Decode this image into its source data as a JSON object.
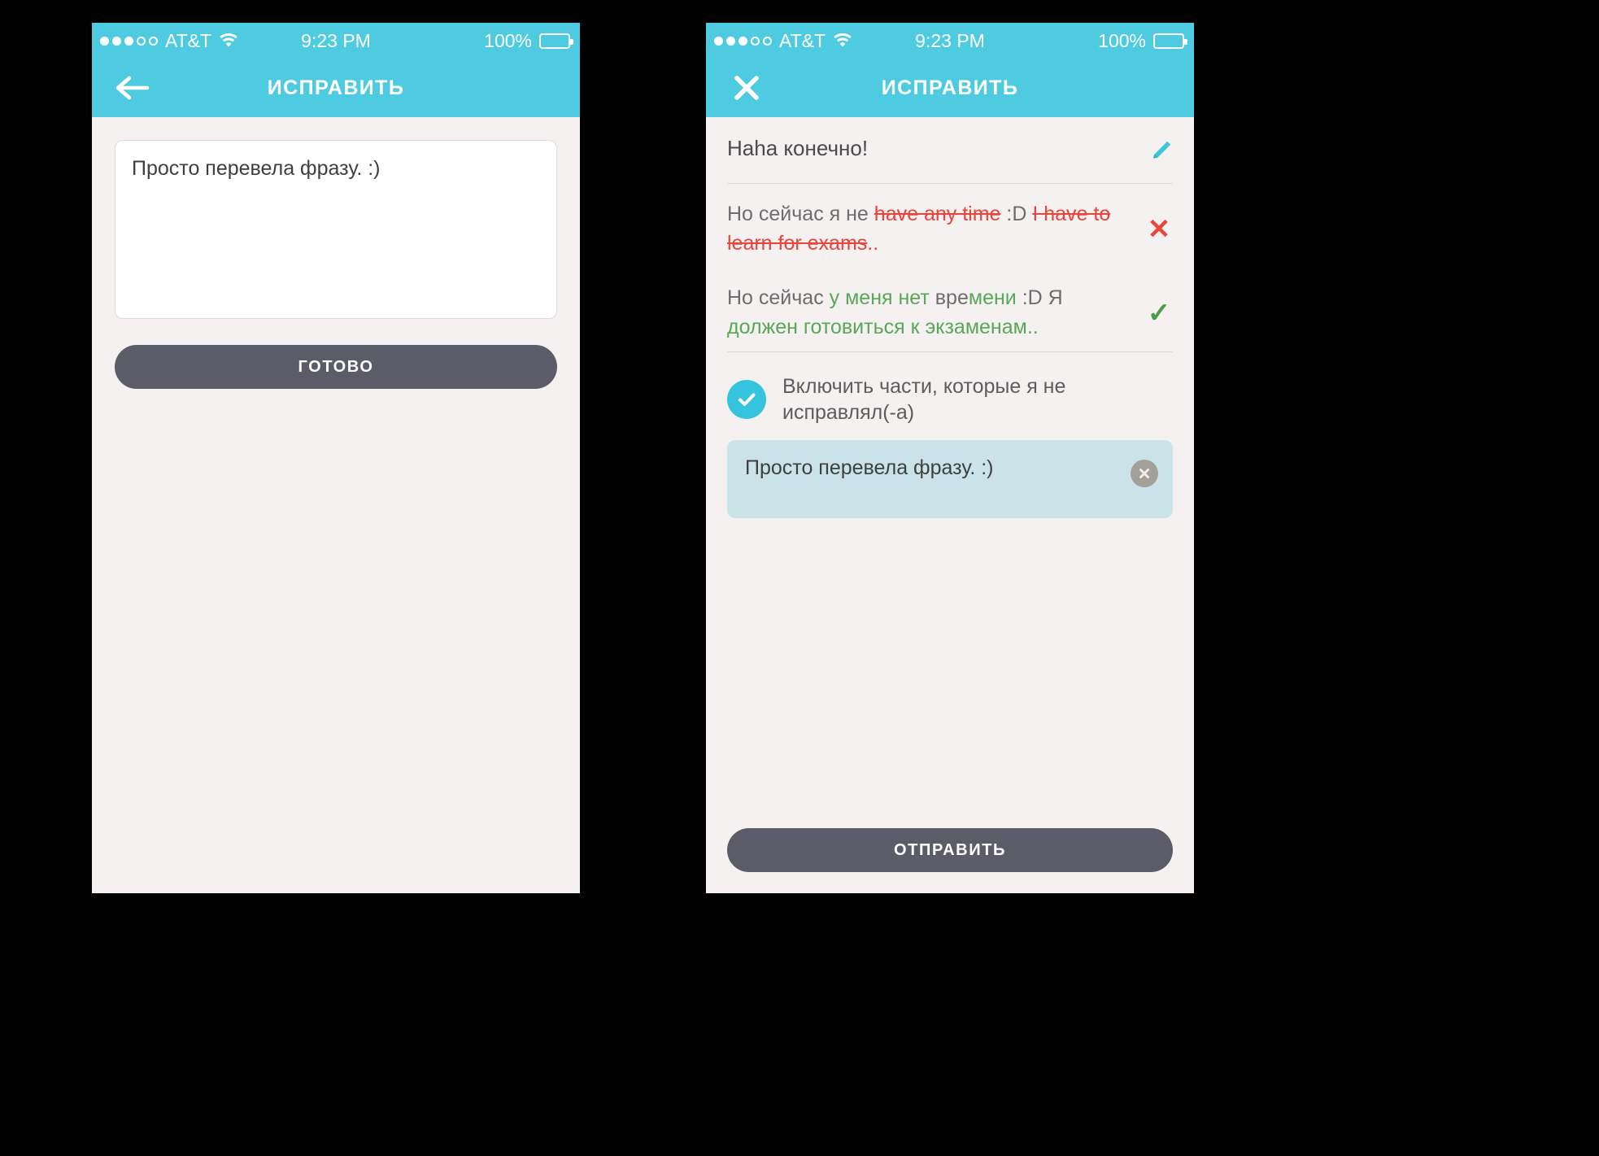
{
  "theme": {
    "accent_cyan": "#4ecbe0",
    "checkbox_cyan": "#35c3dd",
    "button_dark": "#5b5c68",
    "error_red": "#e8453c",
    "success_green": "#5aa75a",
    "chip_blue": "#cae3e8",
    "screen_bg": "#f4f1f0",
    "page_bg": "#000000"
  },
  "status_bar": {
    "signal_dots_filled": 3,
    "signal_dots_total": 5,
    "carrier": "AT&T",
    "wifi_icon": "wifi-icon",
    "time": "9:23 PM",
    "battery_percent": "100%",
    "battery_fill": 100,
    "battery_icon": "battery-icon"
  },
  "screens": [
    {
      "id": "edit-compose",
      "nav": {
        "left_icon": "back-arrow-icon",
        "title": "ИСПРАВИТЬ"
      },
      "textarea": {
        "value": "Просто перевела фразу. :)",
        "placeholder": "Просто перевела фразу. :)"
      },
      "primary_button": "ГОТОВО"
    },
    {
      "id": "edit-review",
      "nav": {
        "left_icon": "close-x-icon",
        "title": "ИСПРАВИТЬ"
      },
      "original": {
        "text": "Haha конечно!",
        "edit_icon": "pencil-icon"
      },
      "corrections": [
        {
          "mark": "✕",
          "mark_icon": "reject-x-icon",
          "segments": [
            {
              "text": "Но сейчас я не ",
              "style": "plain"
            },
            {
              "text": "have any time",
              "style": "strike"
            },
            {
              "text": " :D ",
              "style": "plain"
            },
            {
              "text": "I have to learn for exams",
              "style": "strike"
            },
            {
              "text": "..",
              "style": "strike-plain"
            }
          ]
        },
        {
          "mark": "✓",
          "mark_icon": "accept-check-icon",
          "segments": [
            {
              "text": "Но сейчас ",
              "style": "plain"
            },
            {
              "text": "у меня нет",
              "style": "good"
            },
            {
              "text": " вре",
              "style": "plain"
            },
            {
              "text": "мени",
              "style": "good"
            },
            {
              "text": " :D Я ",
              "style": "plain"
            },
            {
              "text": "должен готовиться к экзаменам..",
              "style": "good"
            }
          ]
        }
      ],
      "checkbox": {
        "checked": true,
        "check_icon": "checkmark-icon",
        "label": "Включить части, которые я не исправлял(-а)"
      },
      "chip": {
        "text": "Просто перевела фразу. :)",
        "close_icon": "chip-close-icon"
      },
      "primary_button": "ОТПРАВИТЬ"
    }
  ]
}
